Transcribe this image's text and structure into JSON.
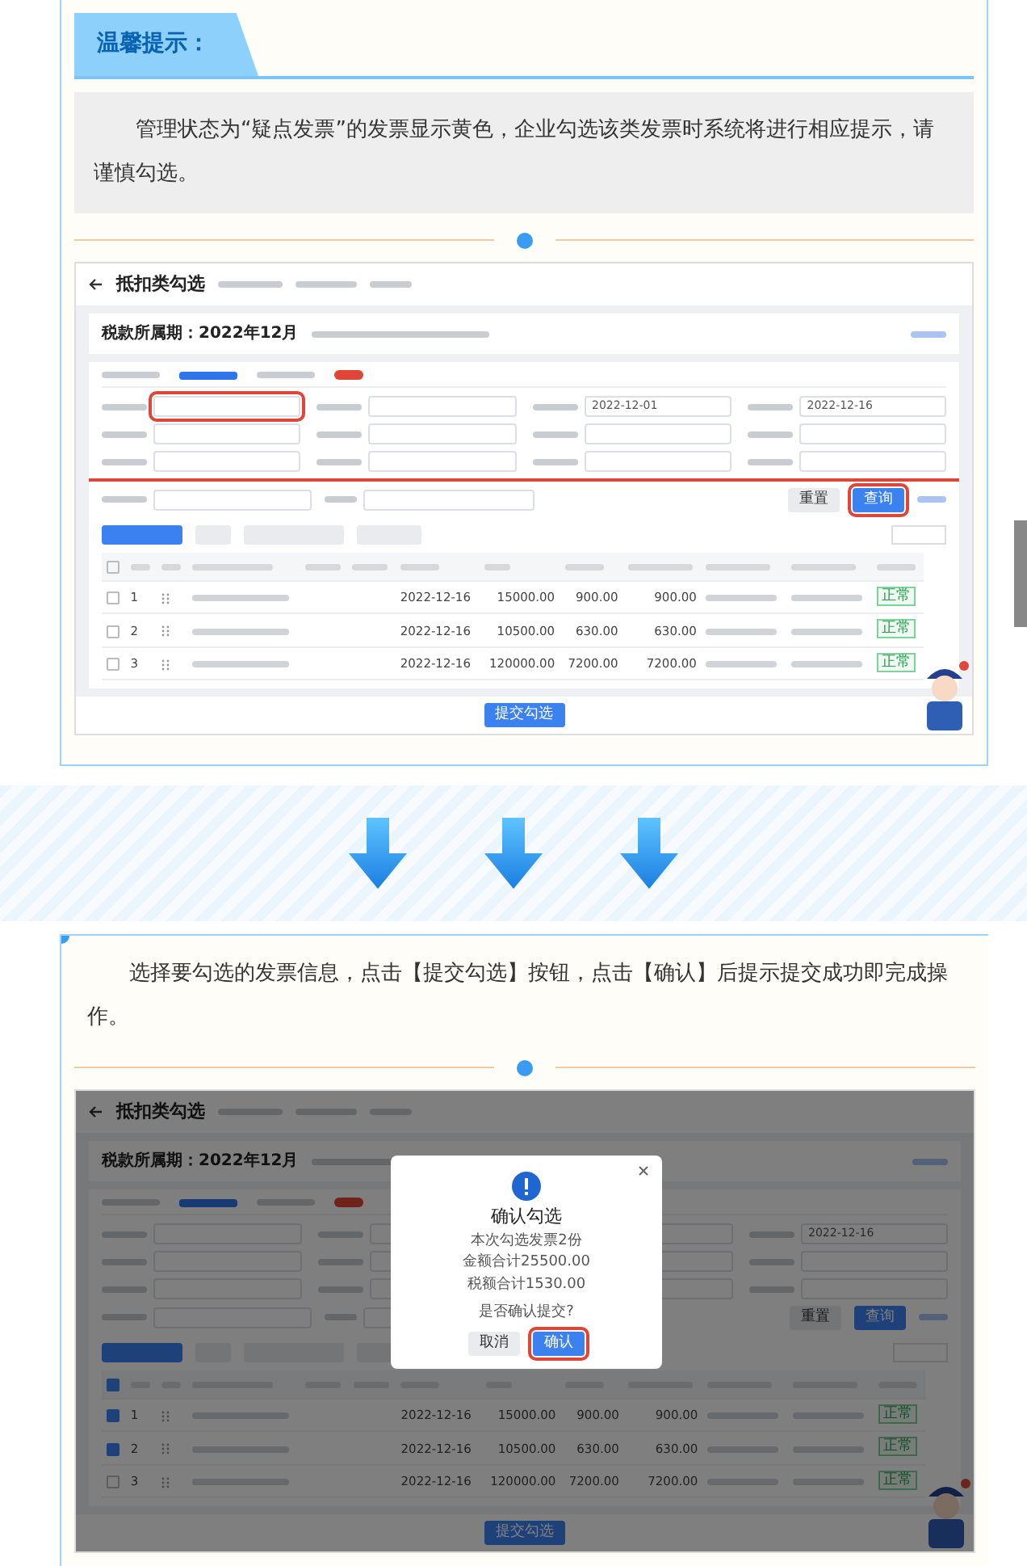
{
  "tip_header": {
    "title": "温馨提示："
  },
  "tip_text": "管理状态为“疑点发票”的发票显示黄色，企业勾选该类发票时系统将进行相应提示，请谨慎勾选。",
  "screenshot_1": {
    "title": "抵扣类勾选",
    "tabs": [
      {
        "selected": false
      },
      {
        "selected": true
      },
      {
        "selected": false
      }
    ],
    "all_checked": false,
    "period_label": "税款所属期：",
    "period": "2022年12月",
    "date_from": "2022-12-01",
    "date_to": "2022-12-16",
    "buttons": [
      {
        "label": "重置",
        "kind": "plain",
        "highlighted": false
      },
      {
        "label": "查询",
        "kind": "primary",
        "highlighted": true
      }
    ],
    "rows": [
      {
        "no": "1",
        "date": "2022-12-16",
        "amount": "15000.00",
        "tax": "900.00",
        "valid_tax": "900.00",
        "status": "正常",
        "checked": false
      },
      {
        "no": "2",
        "date": "2022-12-16",
        "amount": "10500.00",
        "tax": "630.00",
        "valid_tax": "630.00",
        "status": "正常",
        "checked": false
      },
      {
        "no": "3",
        "date": "2022-12-16",
        "amount": "120000.00",
        "tax": "7200.00",
        "valid_tax": "7200.00",
        "status": "正常",
        "checked": false
      }
    ],
    "submit": "提交勾选"
  },
  "step_text": "选择要勾选的发票信息，点击【提交勾选】按钮，点击【确认】后提示提交成功即完成操作。",
  "screenshot_2": {
    "title": "抵扣类勾选",
    "tabs": [
      {
        "selected": false
      },
      {
        "selected": true
      },
      {
        "selected": false
      }
    ],
    "all_checked": true,
    "period_label": "税款所属期：",
    "period": "2022年12月",
    "date_to": "2022-12-16",
    "buttons": [
      {
        "label": "重置",
        "kind": "plain",
        "highlighted": false
      },
      {
        "label": "查询",
        "kind": "primary",
        "highlighted": false
      }
    ],
    "rows": [
      {
        "no": "1",
        "date": "2022-12-16",
        "amount": "15000.00",
        "tax": "900.00",
        "valid_tax": "900.00",
        "status": "正常",
        "checked": true
      },
      {
        "no": "2",
        "date": "2022-12-16",
        "amount": "10500.00",
        "tax": "630.00",
        "valid_tax": "630.00",
        "status": "正常",
        "checked": true
      },
      {
        "no": "3",
        "date": "2022-12-16",
        "amount": "120000.00",
        "tax": "7200.00",
        "valid_tax": "7200.00",
        "status": "正常",
        "checked": false
      }
    ],
    "submit": "提交勾选",
    "dialog": {
      "title": "确认勾选",
      "lines": [
        "本次勾选发票2份",
        "金额合计25500.00",
        "税额合计1530.00"
      ],
      "question": "是否确认提交?",
      "cancel": "取消",
      "confirm": "确认",
      "confirm_highlighted": true
    }
  }
}
